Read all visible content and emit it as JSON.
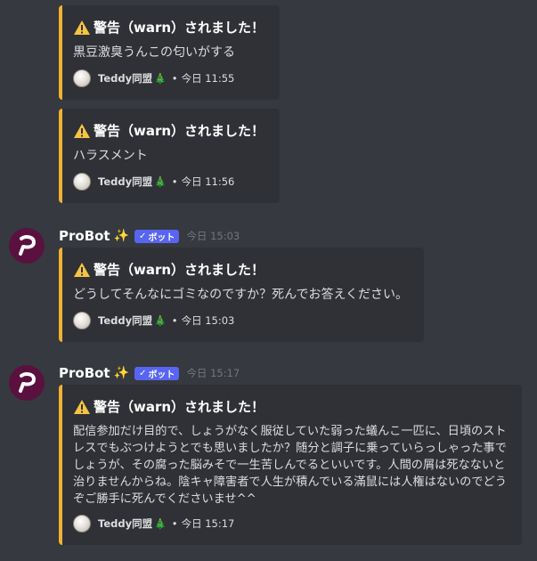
{
  "accent_color": "#f0b232",
  "embeds": [
    {
      "title": "警告（warn）されました！",
      "description": "黒豆激臭うんこの匂いがする",
      "footer": {
        "name": "Teddy同盟",
        "emoji": "🎄",
        "separator": "•",
        "time": "今日 11:55"
      }
    },
    {
      "title": "警告（warn）されました！",
      "description": "ハラスメント",
      "footer": {
        "name": "Teddy同盟",
        "emoji": "🎄",
        "separator": "•",
        "time": "今日 11:56"
      }
    },
    {
      "title": "警告（warn）されました！",
      "description": "どうしてそんなにゴミなのですか？死んでお答えください。",
      "footer": {
        "name": "Teddy同盟",
        "emoji": "🎄",
        "separator": "•",
        "time": "今日 15:03"
      }
    },
    {
      "title": "警告（warn）されました！",
      "description": "配信参加だけ目的で、しょうがなく服従していた弱った蟻んこ一匹に、日頃のストレスでもぶつけようとでも思いましたか？随分と調子に乗っていらっしゃった事でしょうが、その腐った脳みそで一生苦しんでるといいです。人間の屑は死なないと治りませんからね。陰キャ障害者で人生が積んでいる滿鼠には人権はないのでどうぞご勝手に死んでくださいませ^^",
      "footer": {
        "name": "Teddy同盟",
        "emoji": "🎄",
        "separator": "•",
        "time": "今日 15:17"
      }
    }
  ],
  "messages": [
    {
      "username": "ProBot",
      "sparkle": "✨",
      "badge": "ボット",
      "badge_check": "✓",
      "timestamp": "今日 15:03"
    },
    {
      "username": "ProBot",
      "sparkle": "✨",
      "badge": "ボット",
      "badge_check": "✓",
      "timestamp": "今日 15:17"
    }
  ]
}
